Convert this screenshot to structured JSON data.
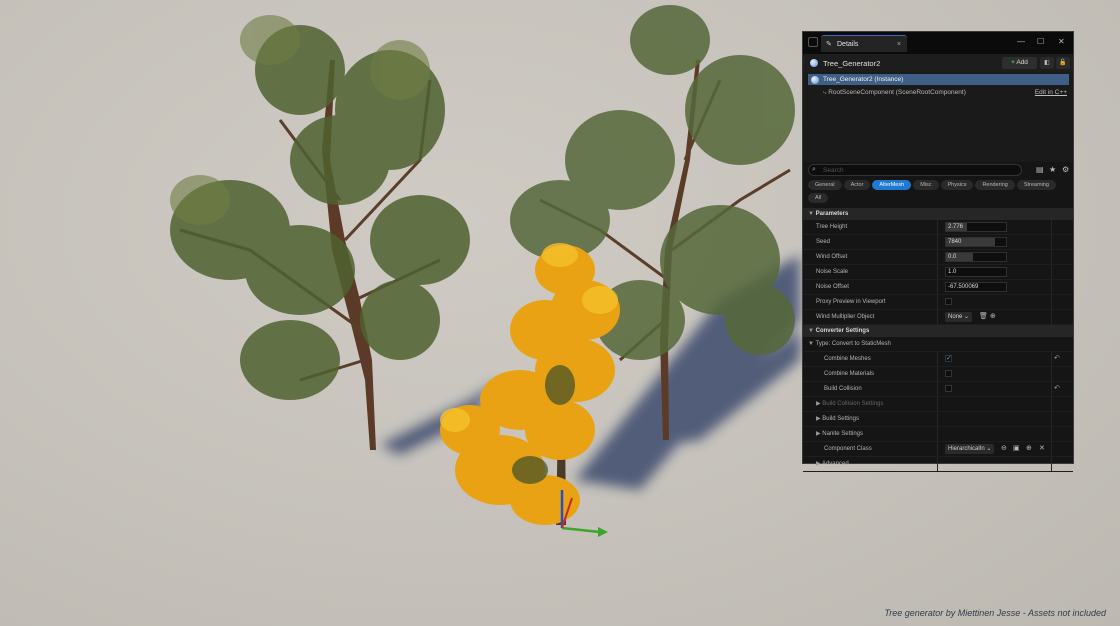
{
  "overlay": {
    "credit": "Tree generator by Miettinen Jesse - Assets not included"
  },
  "details": {
    "tab_label": "Details",
    "actor_name": "Tree_Generator2",
    "add_label": "Add",
    "components": {
      "root": "Tree_Generator2 (Instance)",
      "child": "RootSceneComponent (SceneRootComponent)",
      "edit_link": "Edit in C++"
    },
    "search": {
      "placeholder": "Search"
    },
    "categories": [
      "General",
      "Actor",
      "AlterMesh",
      "Misc",
      "Physics",
      "Rendering",
      "Streaming",
      "All"
    ],
    "active_category": "AlterMesh",
    "parameters": {
      "header": "Parameters",
      "tree_height": {
        "label": "Tree Height",
        "value": "2.776",
        "fill": 0.35
      },
      "seed": {
        "label": "Seed",
        "value": "7840",
        "fill": 0.82
      },
      "wind_offset": {
        "label": "Wind Offset",
        "value": "0.0",
        "fill": 0.45
      },
      "noise_scale": {
        "label": "Noise Scale",
        "value": "1.0"
      },
      "noise_offset": {
        "label": "Noise Offset",
        "value": "-67.500069"
      },
      "proxy_preview": {
        "label": "Proxy Preview in Viewport",
        "checked": false
      },
      "wind_multiplier": {
        "label": "Wind Multiplier Object",
        "value": "None"
      }
    },
    "converter": {
      "header": "Converter Settings",
      "type": "Type: Convert to StaticMesh",
      "combine_meshes": {
        "label": "Combine Meshes",
        "checked": true
      },
      "combine_materials": {
        "label": "Combine Materials",
        "checked": false
      },
      "build_collision": {
        "label": "Build Collision",
        "checked": false
      },
      "build_collision_settings": "Build Collision Settings",
      "build_settings": "Build Settings",
      "nanite_settings": "Nanite Settings",
      "component_class": {
        "label": "Component Class",
        "value": "HierarchicalIn"
      },
      "advanced": "Advanced"
    }
  },
  "colors": {
    "accent": "#1f78d1",
    "selection": "#3f5f86",
    "gizmo_green": "#3aa62a"
  }
}
